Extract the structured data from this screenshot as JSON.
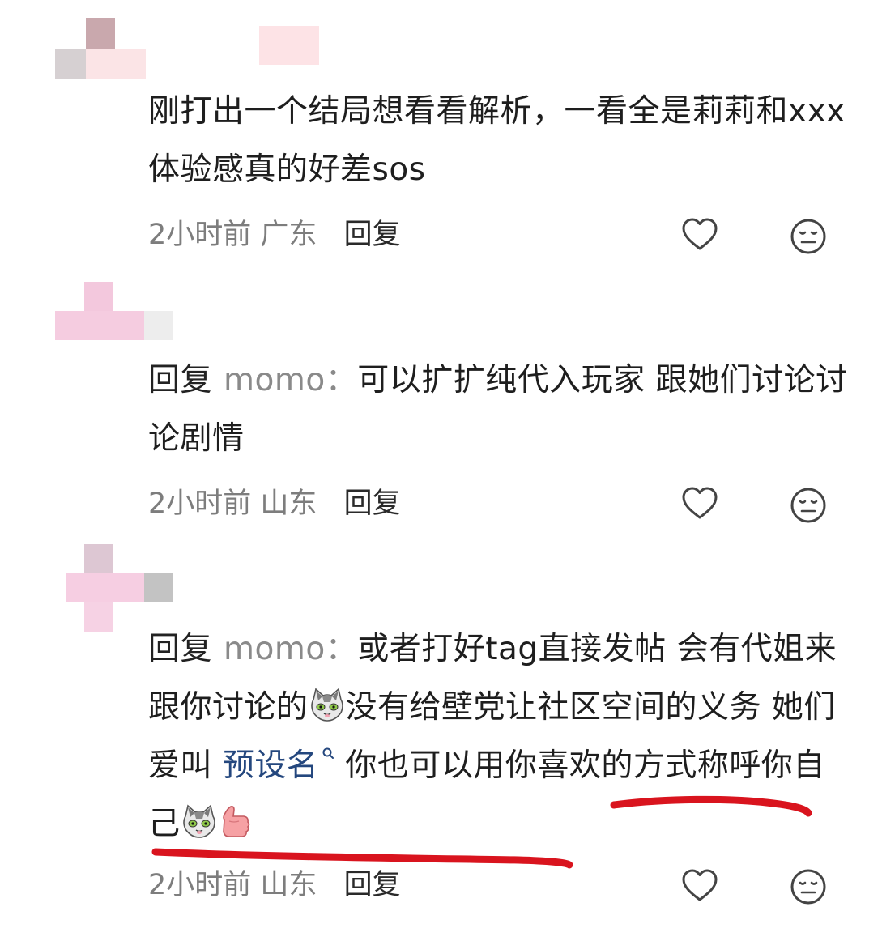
{
  "comments": [
    {
      "text": "刚打出一个结局想看看解析，一看全是莉莉和xxx体验感真的好差sos",
      "time": "2小时前",
      "location": "广东",
      "reply_label": "回复"
    },
    {
      "reply_prefix": "回复",
      "mention": "momo：",
      "text": "可以扩扩纯代入玩家 跟她们讨论讨论剧情",
      "time": "2小时前",
      "location": "山东",
      "reply_label": "回复"
    },
    {
      "reply_prefix": "回复",
      "mention": "momo：",
      "text_a": "或者打好tag直接发帖 会有代姐来跟你讨论的",
      "text_b": "没有给壁党让社区空间的义务 她们爱叫 ",
      "tag_link": "预设名",
      "text_c": " 你也可以用你喜欢的方式称呼你自己",
      "time": "2小时前",
      "location": "山东",
      "reply_label": "回复"
    }
  ],
  "icons": {
    "like": "heart-icon",
    "dislike": "meh-face-icon",
    "sticker": "cat-sticker-icon",
    "thumb": "thumbs-up-icon",
    "tag": "search-mark-icon"
  },
  "colors": {
    "annotation": "#d9141e",
    "link": "#24477e",
    "meta": "#7d7d7d"
  }
}
